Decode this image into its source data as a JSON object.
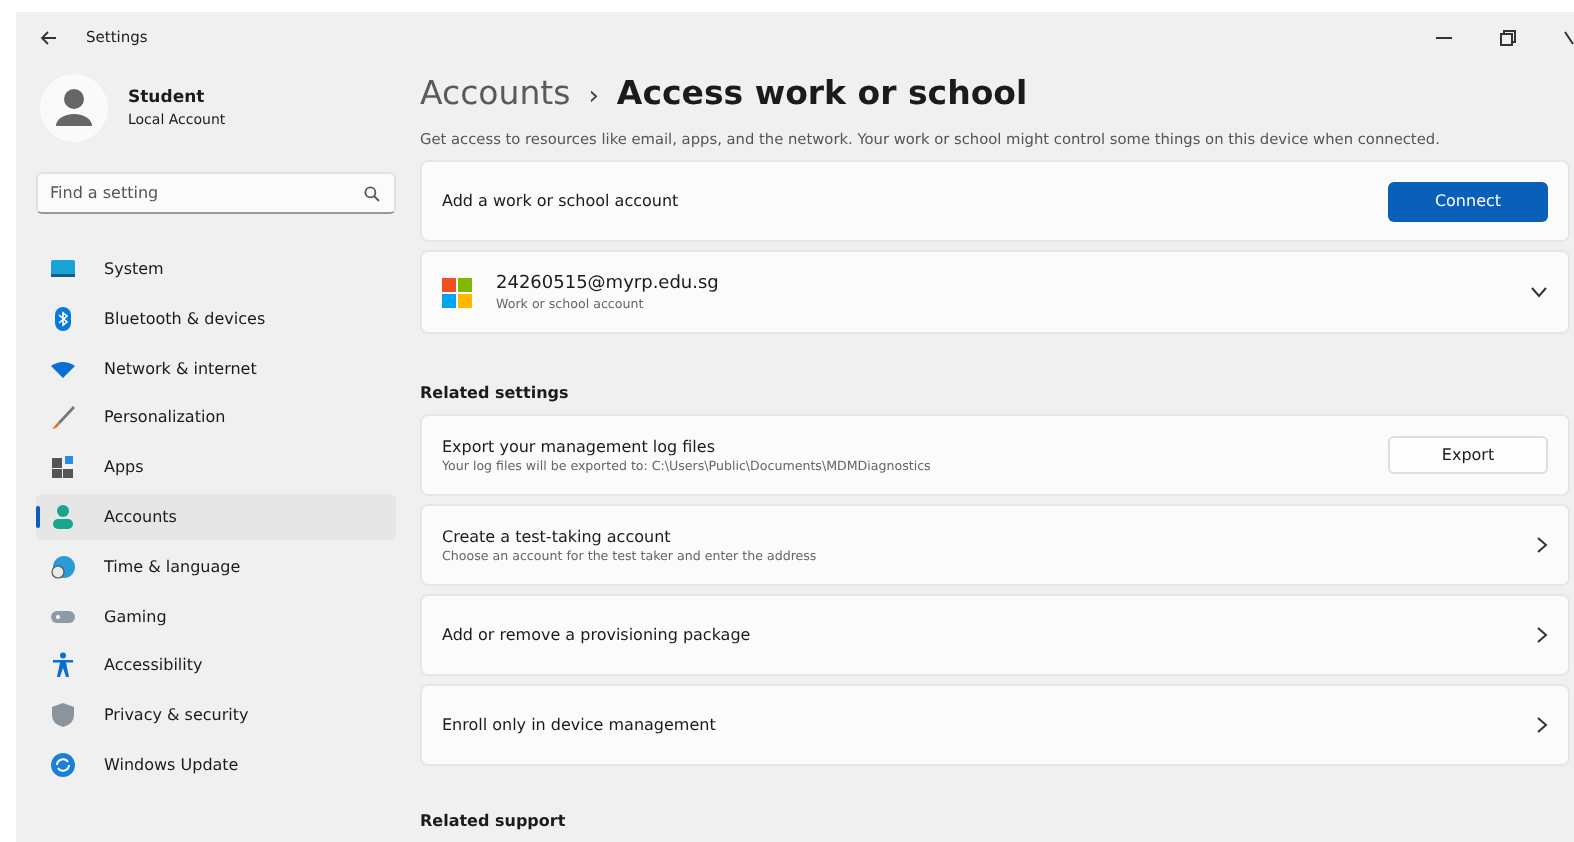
{
  "window": {
    "title": "Settings"
  },
  "profile": {
    "name": "Student",
    "account_type": "Local Account"
  },
  "search": {
    "placeholder": "Find a setting"
  },
  "nav_items": [
    {
      "label": "System",
      "selected": false
    },
    {
      "label": "Bluetooth & devices",
      "selected": false
    },
    {
      "label": "Network & internet",
      "selected": false
    },
    {
      "label": "Personalization",
      "selected": false
    },
    {
      "label": "Apps",
      "selected": false
    },
    {
      "label": "Accounts",
      "selected": true
    },
    {
      "label": "Time & language",
      "selected": false
    },
    {
      "label": "Gaming",
      "selected": false
    },
    {
      "label": "Accessibility",
      "selected": false
    },
    {
      "label": "Privacy & security",
      "selected": false
    },
    {
      "label": "Windows Update",
      "selected": false
    }
  ],
  "breadcrumb": {
    "parent": "Accounts",
    "separator": "›",
    "current": "Access work or school"
  },
  "description": "Get access to resources like email, apps, and the network. Your work or school might control some things on this device when connected.",
  "add_account": {
    "label": "Add a work or school account",
    "button": "Connect"
  },
  "accounts": [
    {
      "email": "24260515@myrp.edu.sg",
      "type": "Work or school account",
      "expanded": false
    }
  ],
  "related_settings": {
    "heading": "Related settings",
    "rows": [
      {
        "kind": "button",
        "title": "Export your management log files",
        "subtitle": "Your log files will be exported to: C:\\Users\\Public\\Documents\\MDMDiagnostics",
        "button": "Export"
      },
      {
        "kind": "chevron",
        "title": "Create a test-taking account",
        "subtitle": "Choose an account for the test taker and enter the address"
      },
      {
        "kind": "chevron",
        "title": "Add or remove a provisioning package"
      },
      {
        "kind": "chevron",
        "title": "Enroll only in device management"
      }
    ]
  },
  "related_support": {
    "heading": "Related support"
  }
}
